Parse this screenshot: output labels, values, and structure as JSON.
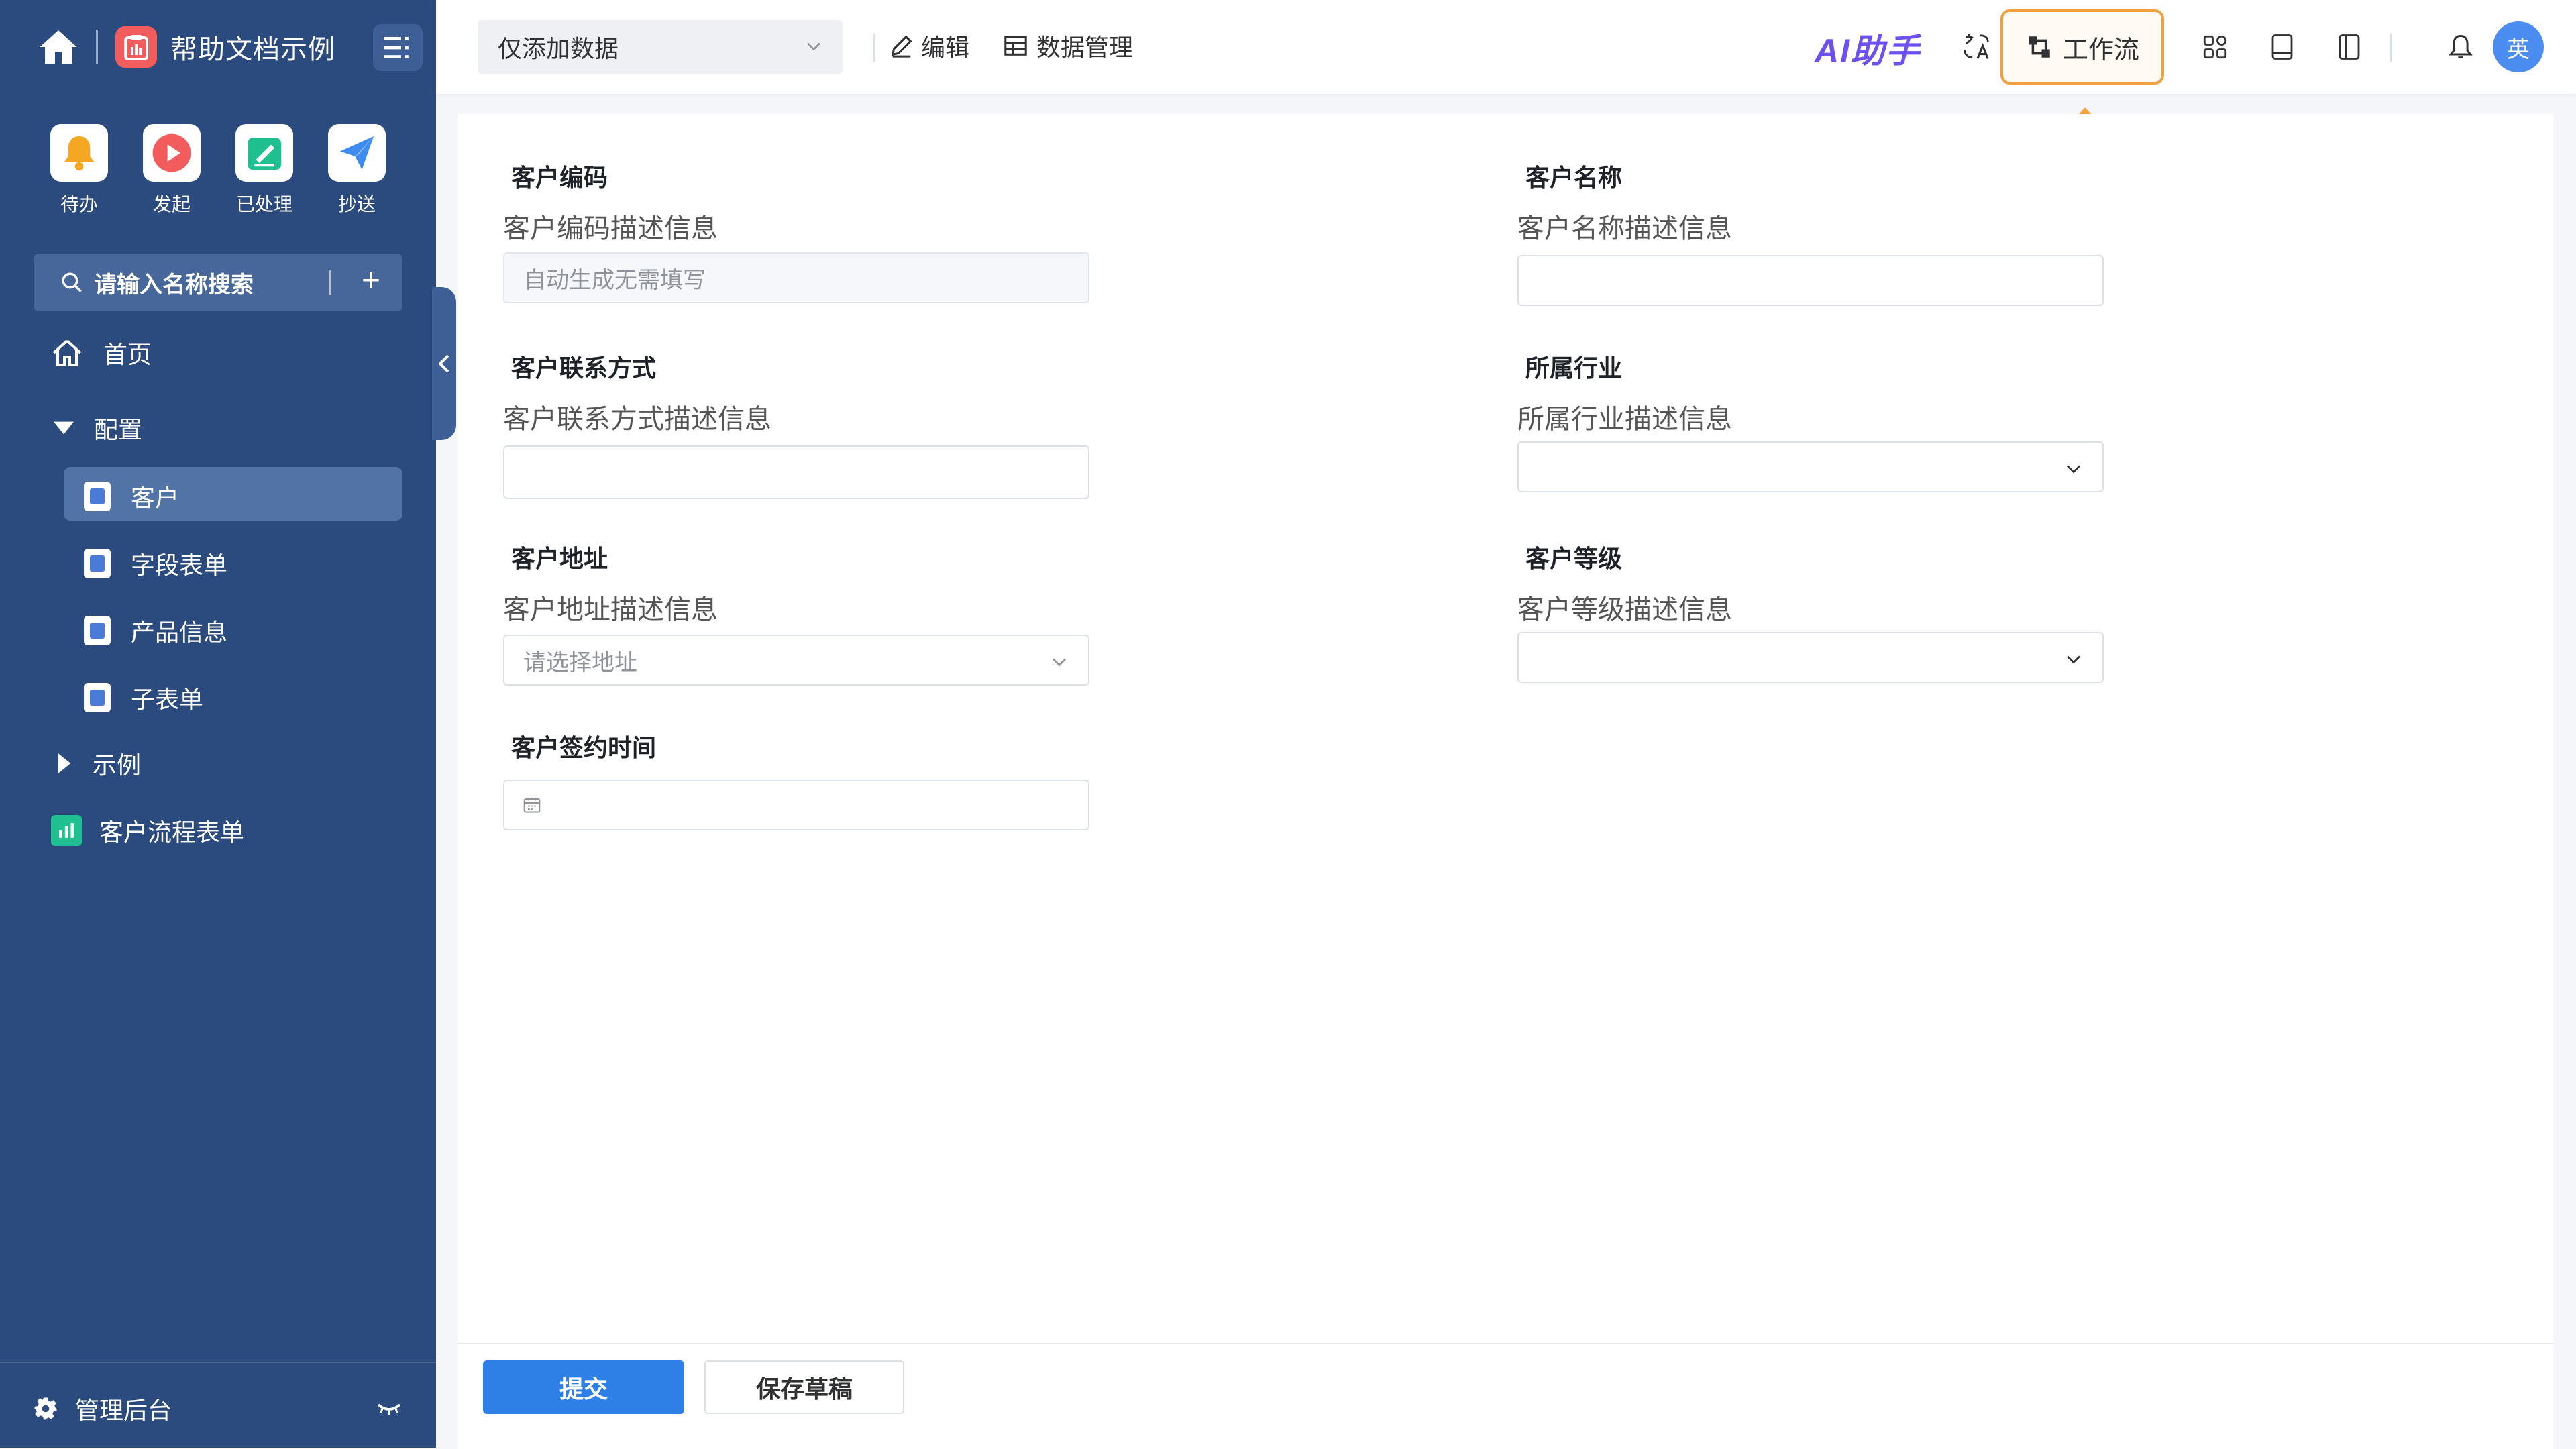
{
  "sidebar": {
    "app_title": "帮助文档示例",
    "quick_actions": [
      {
        "label": "待办",
        "icon": "bell-icon",
        "color": "#f5a623"
      },
      {
        "label": "发起",
        "icon": "play-icon",
        "color": "#f25c5c"
      },
      {
        "label": "已处理",
        "icon": "edit-check-icon",
        "color": "#1fbf8f"
      },
      {
        "label": "抄送",
        "icon": "paper-plane-icon",
        "color": "#3f8cf0"
      }
    ],
    "search_placeholder": "请输入名称搜索",
    "nav": {
      "home": "首页",
      "config_group": "配置",
      "config_items": [
        "客户",
        "字段表单",
        "产品信息",
        "子表单"
      ],
      "active_item": "客户",
      "example_group": "示例",
      "flow_form": "客户流程表单"
    },
    "footer_label": "管理后台"
  },
  "header": {
    "view_select": "仅添加数据",
    "edit_label": "编辑",
    "data_manage_label": "数据管理",
    "ai_label": "AI助手",
    "workflow_label": "工作流",
    "avatar_text": "英"
  },
  "form": {
    "fields": [
      {
        "label": "客户编码",
        "desc": "客户编码描述信息",
        "placeholder": "自动生成无需填写",
        "type": "disabled"
      },
      {
        "label": "客户名称",
        "desc": "客户名称描述信息",
        "placeholder": "",
        "type": "text"
      },
      {
        "label": "客户联系方式",
        "desc": "客户联系方式描述信息",
        "placeholder": "",
        "type": "text"
      },
      {
        "label": "所属行业",
        "desc": "所属行业描述信息",
        "placeholder": "",
        "type": "select"
      },
      {
        "label": "客户地址",
        "desc": "客户地址描述信息",
        "placeholder": "请选择地址",
        "type": "select"
      },
      {
        "label": "客户等级",
        "desc": "客户等级描述信息",
        "placeholder": "",
        "type": "select"
      },
      {
        "label": "客户签约时间",
        "desc": "",
        "placeholder": "",
        "type": "date"
      }
    ]
  },
  "footer": {
    "submit_label": "提交",
    "draft_label": "保存草稿"
  }
}
